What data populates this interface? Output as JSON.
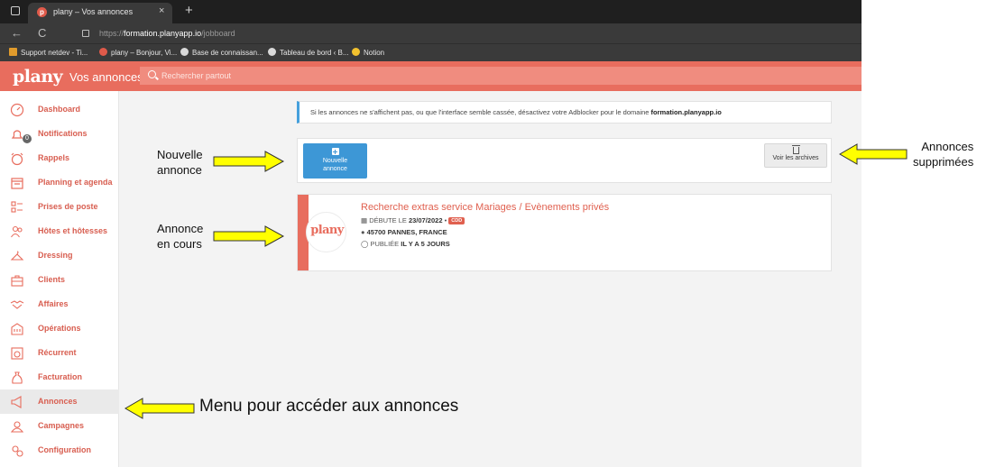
{
  "browser": {
    "tab_title": "plany – Vos annonces",
    "tab_favicon": "p",
    "close_glyph": "×",
    "new_tab_glyph": "+",
    "back_glyph": "←",
    "reload_glyph": "C",
    "url_prefix": "https://",
    "url_host": "formation.planyapp.io",
    "url_path": "/jobboard",
    "bookmarks": [
      "Support netdev - Ti...",
      "plany – Bonjour, Vi...",
      "Base de connaissan...",
      "Tableau de bord ‹ B...",
      "Notion"
    ]
  },
  "app": {
    "logo": "plany",
    "page_title": "Vos annonces",
    "search_placeholder": "Rechercher partout",
    "accent_color": "#e86d5e"
  },
  "sidebar": {
    "items": [
      {
        "label": "Dashboard",
        "icon": "gauge-icon"
      },
      {
        "label": "Notifications",
        "icon": "bell-icon",
        "badge": "0"
      },
      {
        "label": "Rappels",
        "icon": "alarm-clock-icon"
      },
      {
        "label": "Planning et agenda",
        "icon": "calendar-icon"
      },
      {
        "label": "Prises de poste",
        "icon": "checklist-icon"
      },
      {
        "label": "Hôtes et hôtesses",
        "icon": "people-icon"
      },
      {
        "label": "Dressing",
        "icon": "hanger-icon"
      },
      {
        "label": "Clients",
        "icon": "briefcase-icon"
      },
      {
        "label": "Affaires",
        "icon": "handshake-icon"
      },
      {
        "label": "Opérations",
        "icon": "building-icon"
      },
      {
        "label": "Récurrent",
        "icon": "recurring-calendar-icon"
      },
      {
        "label": "Facturation",
        "icon": "money-bag-icon"
      },
      {
        "label": "Annonces",
        "icon": "megaphone-icon",
        "active": true
      },
      {
        "label": "Campagnes",
        "icon": "campaign-icon"
      },
      {
        "label": "Configuration",
        "icon": "gears-icon"
      }
    ]
  },
  "main": {
    "notice_text": "Si les annonces ne s'affichent pas, ou que l'interface semble cassée, désactivez votre Adblocker pour le domaine ",
    "notice_domain": "formation.planyapp.io",
    "new_button": {
      "line1": "Nouvelle",
      "line2": "annonce"
    },
    "archive_button": "Voir les archives",
    "job": {
      "title": "Recherche extras service Mariages / Evènements privés",
      "start_label": "DÉBUTE LE ",
      "start_date": "23/07/2022",
      "separator": " • ",
      "contract": "CDD",
      "location": "45700 PANNES, FRANCE",
      "published_label": "PUBLIÉE ",
      "published_value": "IL Y A 5 JOURS",
      "logo": "plany"
    }
  },
  "annotations": {
    "new_ad": [
      "Nouvelle",
      "annonce"
    ],
    "current_ad": [
      "Annonce",
      "en cours"
    ],
    "deleted_ads": [
      "Annonces",
      "supprimées"
    ],
    "menu": "Menu pour accéder aux annonces",
    "arrow_color": "#ffff00"
  }
}
